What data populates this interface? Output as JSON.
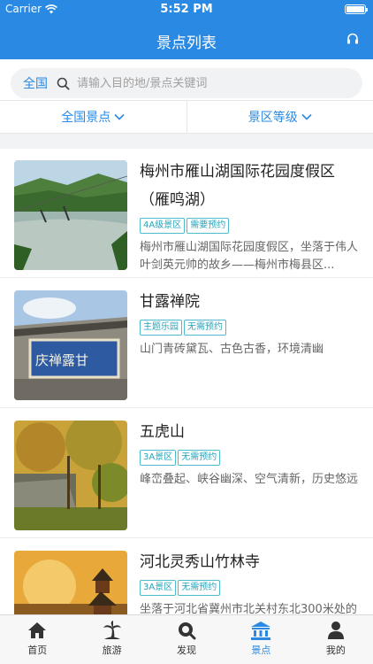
{
  "status": {
    "carrier": "Carrier",
    "time": "5:52 PM"
  },
  "nav": {
    "title": "景点列表"
  },
  "search": {
    "scope": "全国",
    "placeholder": "请输入目的地/景点关键词"
  },
  "filters": [
    {
      "label": "全国景点"
    },
    {
      "label": "景区等级"
    }
  ],
  "spots": [
    {
      "name": "梅州市雁山湖国际花园度假区（雁鸣湖）",
      "tags": [
        "4A级景区",
        "需要预约"
      ],
      "description": "梅州市雁山湖国际花园度假区，坐落于伟人叶剑英元帅的故乡——梅州市梅县区..."
    },
    {
      "name": "甘露禅院",
      "tags": [
        "主题乐园",
        "无需预约"
      ],
      "description": "山门青砖黛瓦、古色古香，环境清幽"
    },
    {
      "name": "五虎山",
      "tags": [
        "3A景区",
        "无需预约"
      ],
      "description": "峰峦叠起、峡谷幽深、空气清新，历史悠远"
    },
    {
      "name": "河北灵秀山竹林寺",
      "tags": [
        "3A景区",
        "无需预约"
      ],
      "description": "坐落于河北省冀州市北关村东北300米处的"
    }
  ],
  "thumb_text": "庆禅露甘",
  "tabs": [
    {
      "label": "首页",
      "icon": "home-icon"
    },
    {
      "label": "旅游",
      "icon": "palm-tree-icon"
    },
    {
      "label": "发现",
      "icon": "discover-icon"
    },
    {
      "label": "景点",
      "icon": "temple-icon"
    },
    {
      "label": "我的",
      "icon": "user-icon"
    }
  ],
  "colors": {
    "primary": "#2a8ae3",
    "tag": "#27a3b8",
    "tab_inactive": "#333333"
  }
}
